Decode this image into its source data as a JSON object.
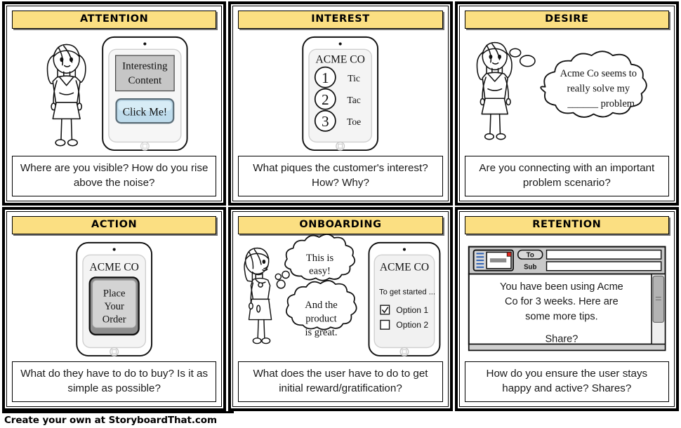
{
  "meta": {
    "footer_text": "Create your own at StoryboardThat.com",
    "accent_yellow": "#FBDF82",
    "outline_black": "#000000",
    "device_screen_gray": "#C6C6C6",
    "click_button_blue": "#BFDCEC"
  },
  "panels": [
    {
      "id": "attention",
      "title": "ATTENTION",
      "caption": "Where are you visible? How do you rise above the noise?",
      "device": {
        "brand": "",
        "content_box_text_line1": "Interesting",
        "content_box_text_line2": "Content",
        "button_label": "Click Me!"
      }
    },
    {
      "id": "interest",
      "title": "INTEREST",
      "caption": "What piques the customer's interest? How? Why?",
      "device": {
        "brand": "ACME CO",
        "list": [
          {
            "number": "1",
            "label": "Tic"
          },
          {
            "number": "2",
            "label": "Tac"
          },
          {
            "number": "3",
            "label": "Toe"
          }
        ]
      }
    },
    {
      "id": "desire",
      "title": "DESIRE",
      "caption": "Are you connecting with an important problem scenario?",
      "thought": {
        "line1": "Acme Co seems to",
        "line2": "really solve my",
        "line3": "______ problem"
      }
    },
    {
      "id": "action",
      "title": "ACTION",
      "caption": "What do they have to do to buy? Is it as simple as possible?",
      "device": {
        "brand": "ACME CO",
        "button_line1": "Place",
        "button_line2": "Your",
        "button_line3": "Order"
      }
    },
    {
      "id": "onboarding",
      "title": "ONBOARDING",
      "caption": "What does the user have to do to get initial reward/gratification?",
      "thoughts": [
        {
          "line1": "This is",
          "line2": "easy!"
        },
        {
          "line1": "And the",
          "line2": "product",
          "line3": "is great."
        }
      ],
      "device": {
        "brand": "ACME CO",
        "prompt": "To get started ...",
        "options": [
          {
            "label": "Option 1",
            "checked": true
          },
          {
            "label": "Option 2",
            "checked": false
          }
        ]
      }
    },
    {
      "id": "retention",
      "title": "RETENTION",
      "caption": "How do you ensure the user stays happy and active? Shares?",
      "email": {
        "to_label": "To",
        "to_value": "",
        "subject_label": "Sub",
        "subject_value": "",
        "body_line1": "You have been using Acme",
        "body_line2": "Co for 3 weeks. Here are",
        "body_line3": "some more tips.",
        "body_line4": "Share?"
      }
    }
  ]
}
